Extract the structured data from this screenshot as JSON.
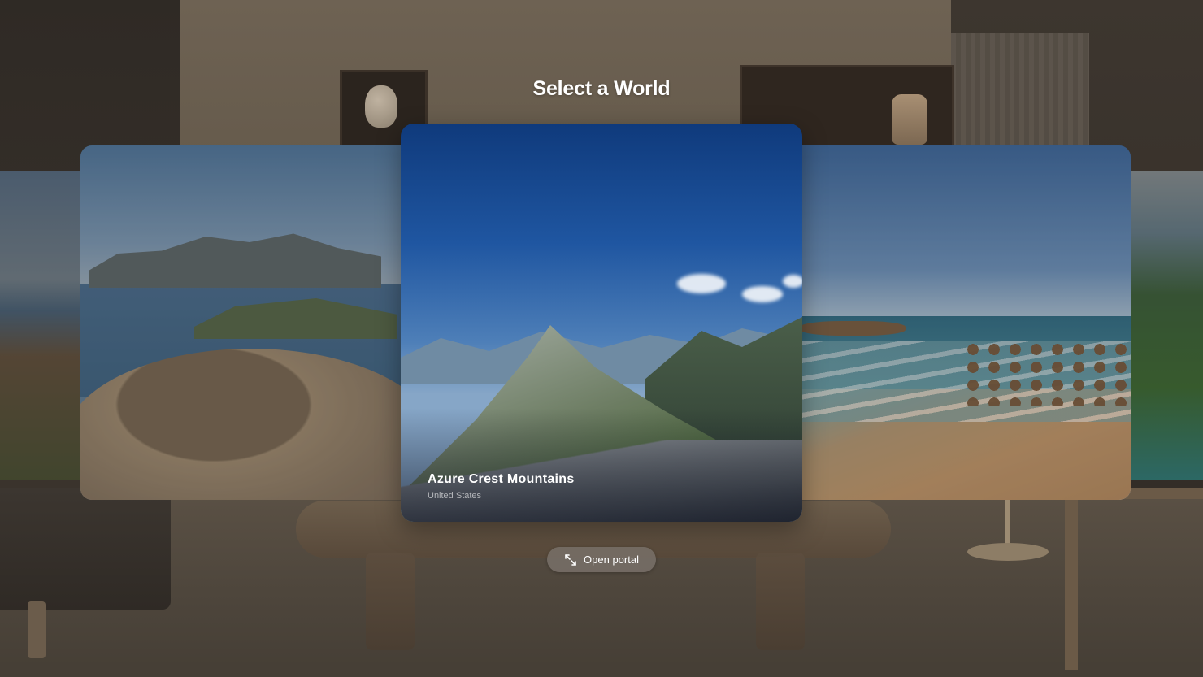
{
  "header": {
    "title": "Select a World"
  },
  "worlds": [
    {
      "id": "left",
      "position": "left"
    },
    {
      "id": "center",
      "title": "Azure Crest Mountains",
      "subtitle": "United States",
      "selected": true
    },
    {
      "id": "right",
      "position": "right"
    }
  ],
  "actions": {
    "open_portal": {
      "label": "Open portal",
      "icon": "expand-arrows-icon"
    }
  },
  "colors": {
    "title_text": "#ffffff",
    "button_bg": "#787068"
  }
}
